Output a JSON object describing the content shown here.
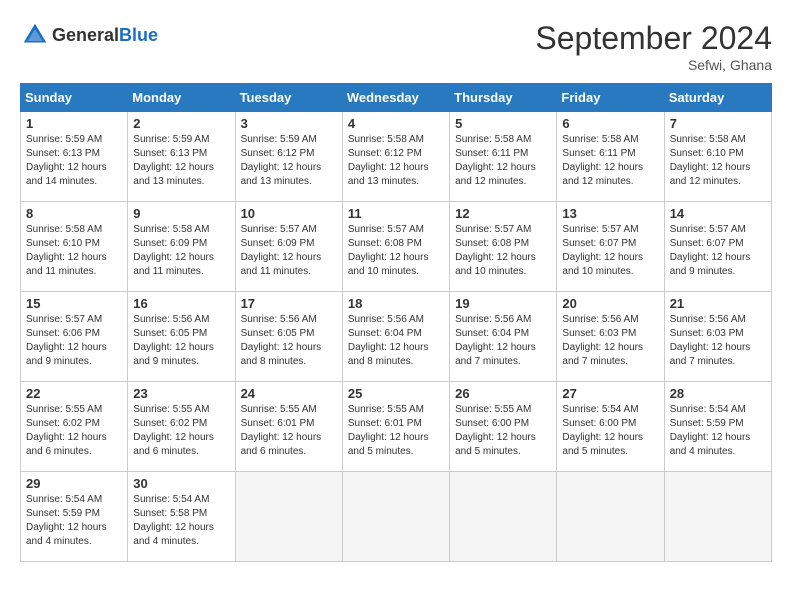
{
  "header": {
    "logo_general": "General",
    "logo_blue": "Blue",
    "title": "September 2024",
    "location": "Sefwi, Ghana"
  },
  "days_of_week": [
    "Sunday",
    "Monday",
    "Tuesday",
    "Wednesday",
    "Thursday",
    "Friday",
    "Saturday"
  ],
  "weeks": [
    [
      {
        "day": "1",
        "sunrise": "5:59 AM",
        "sunset": "6:13 PM",
        "daylight": "12 hours and 14 minutes."
      },
      {
        "day": "2",
        "sunrise": "5:59 AM",
        "sunset": "6:13 PM",
        "daylight": "12 hours and 13 minutes."
      },
      {
        "day": "3",
        "sunrise": "5:59 AM",
        "sunset": "6:12 PM",
        "daylight": "12 hours and 13 minutes."
      },
      {
        "day": "4",
        "sunrise": "5:58 AM",
        "sunset": "6:12 PM",
        "daylight": "12 hours and 13 minutes."
      },
      {
        "day": "5",
        "sunrise": "5:58 AM",
        "sunset": "6:11 PM",
        "daylight": "12 hours and 12 minutes."
      },
      {
        "day": "6",
        "sunrise": "5:58 AM",
        "sunset": "6:11 PM",
        "daylight": "12 hours and 12 minutes."
      },
      {
        "day": "7",
        "sunrise": "5:58 AM",
        "sunset": "6:10 PM",
        "daylight": "12 hours and 12 minutes."
      }
    ],
    [
      {
        "day": "8",
        "sunrise": "5:58 AM",
        "sunset": "6:10 PM",
        "daylight": "12 hours and 11 minutes."
      },
      {
        "day": "9",
        "sunrise": "5:58 AM",
        "sunset": "6:09 PM",
        "daylight": "12 hours and 11 minutes."
      },
      {
        "day": "10",
        "sunrise": "5:57 AM",
        "sunset": "6:09 PM",
        "daylight": "12 hours and 11 minutes."
      },
      {
        "day": "11",
        "sunrise": "5:57 AM",
        "sunset": "6:08 PM",
        "daylight": "12 hours and 10 minutes."
      },
      {
        "day": "12",
        "sunrise": "5:57 AM",
        "sunset": "6:08 PM",
        "daylight": "12 hours and 10 minutes."
      },
      {
        "day": "13",
        "sunrise": "5:57 AM",
        "sunset": "6:07 PM",
        "daylight": "12 hours and 10 minutes."
      },
      {
        "day": "14",
        "sunrise": "5:57 AM",
        "sunset": "6:07 PM",
        "daylight": "12 hours and 9 minutes."
      }
    ],
    [
      {
        "day": "15",
        "sunrise": "5:57 AM",
        "sunset": "6:06 PM",
        "daylight": "12 hours and 9 minutes."
      },
      {
        "day": "16",
        "sunrise": "5:56 AM",
        "sunset": "6:05 PM",
        "daylight": "12 hours and 9 minutes."
      },
      {
        "day": "17",
        "sunrise": "5:56 AM",
        "sunset": "6:05 PM",
        "daylight": "12 hours and 8 minutes."
      },
      {
        "day": "18",
        "sunrise": "5:56 AM",
        "sunset": "6:04 PM",
        "daylight": "12 hours and 8 minutes."
      },
      {
        "day": "19",
        "sunrise": "5:56 AM",
        "sunset": "6:04 PM",
        "daylight": "12 hours and 7 minutes."
      },
      {
        "day": "20",
        "sunrise": "5:56 AM",
        "sunset": "6:03 PM",
        "daylight": "12 hours and 7 minutes."
      },
      {
        "day": "21",
        "sunrise": "5:56 AM",
        "sunset": "6:03 PM",
        "daylight": "12 hours and 7 minutes."
      }
    ],
    [
      {
        "day": "22",
        "sunrise": "5:55 AM",
        "sunset": "6:02 PM",
        "daylight": "12 hours and 6 minutes."
      },
      {
        "day": "23",
        "sunrise": "5:55 AM",
        "sunset": "6:02 PM",
        "daylight": "12 hours and 6 minutes."
      },
      {
        "day": "24",
        "sunrise": "5:55 AM",
        "sunset": "6:01 PM",
        "daylight": "12 hours and 6 minutes."
      },
      {
        "day": "25",
        "sunrise": "5:55 AM",
        "sunset": "6:01 PM",
        "daylight": "12 hours and 5 minutes."
      },
      {
        "day": "26",
        "sunrise": "5:55 AM",
        "sunset": "6:00 PM",
        "daylight": "12 hours and 5 minutes."
      },
      {
        "day": "27",
        "sunrise": "5:54 AM",
        "sunset": "6:00 PM",
        "daylight": "12 hours and 5 minutes."
      },
      {
        "day": "28",
        "sunrise": "5:54 AM",
        "sunset": "5:59 PM",
        "daylight": "12 hours and 4 minutes."
      }
    ],
    [
      {
        "day": "29",
        "sunrise": "5:54 AM",
        "sunset": "5:59 PM",
        "daylight": "12 hours and 4 minutes."
      },
      {
        "day": "30",
        "sunrise": "5:54 AM",
        "sunset": "5:58 PM",
        "daylight": "12 hours and 4 minutes."
      },
      null,
      null,
      null,
      null,
      null
    ]
  ]
}
